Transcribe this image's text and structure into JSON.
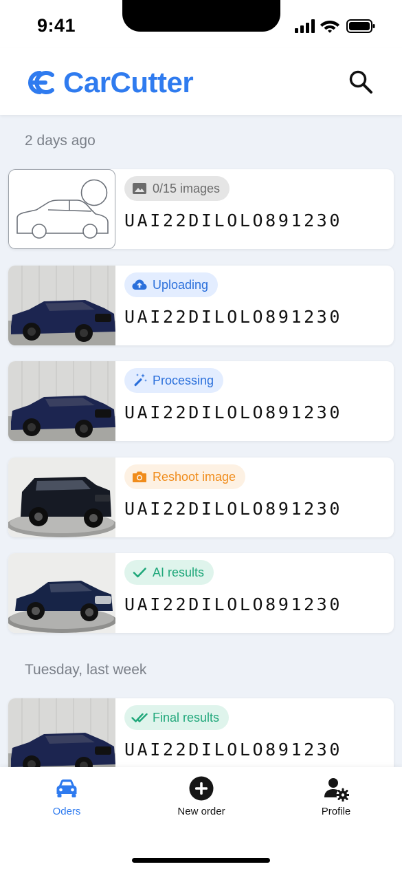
{
  "status_bar": {
    "time": "9:41"
  },
  "header": {
    "brand": "CarCutter",
    "brand_color": "#2f7bef"
  },
  "sections": [
    {
      "label": "2 days ago"
    },
    {
      "label": "Tuesday, last week"
    }
  ],
  "orders": [
    {
      "status": "0/15 images",
      "status_icon": "image-icon",
      "code": "UAI22DILOLO891230",
      "thumb": "placeholder-car"
    },
    {
      "status": "Uploading",
      "status_icon": "cloud-upload-icon",
      "code": "UAI22DILOLO891230",
      "thumb": "blue-sedan-wall"
    },
    {
      "status": "Processing",
      "status_icon": "magic-wand-icon",
      "code": "UAI22DILOLO891230",
      "thumb": "blue-sedan-wall"
    },
    {
      "status": "Reshoot image",
      "status_icon": "camera-icon",
      "code": "UAI22DILOLO891230",
      "thumb": "dark-suv-turntable"
    },
    {
      "status": "AI results",
      "status_icon": "check-icon",
      "code": "UAI22DILOLO891230",
      "thumb": "blue-sedan-turntable"
    },
    {
      "status": "Final results",
      "status_icon": "double-check-icon",
      "code": "UAI22DILOLO891230",
      "thumb": "blue-sedan-wall"
    }
  ],
  "tabs": [
    {
      "label": "Oders",
      "icon": "car-icon",
      "active": true
    },
    {
      "label": "New order",
      "icon": "plus-circle-icon",
      "active": false
    },
    {
      "label": "Profile",
      "icon": "user-settings-icon",
      "active": false
    }
  ],
  "colors": {
    "accent": "#2f7bef",
    "background": "#eef2f8",
    "uploading": "#2a6fdb",
    "reshoot": "#f08c1b",
    "ai": "#1fa77a"
  }
}
